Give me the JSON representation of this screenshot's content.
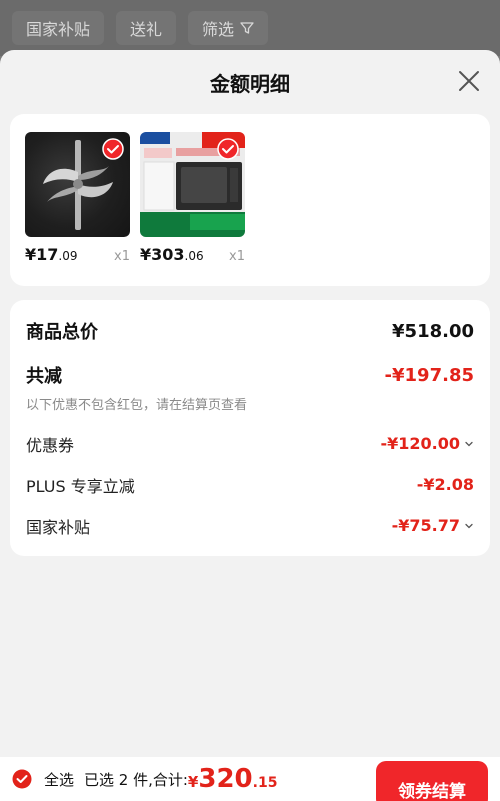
{
  "filter_bar": {
    "chips": [
      "国家补贴",
      "送礼",
      "筛选"
    ]
  },
  "sheet": {
    "title": "金额明细",
    "products": [
      {
        "price_int": "¥17",
        "price_dec": ".09",
        "qty": "x1",
        "image": "blade-attachment"
      },
      {
        "price_int": "¥303",
        "price_dec": ".06",
        "qty": "x1",
        "image": "microwave-oven"
      }
    ],
    "summary": {
      "total_label": "商品总价",
      "total_value": "¥518.00",
      "reduce_label": "共减",
      "reduce_value": "-¥197.85",
      "note": "以下优惠不包含红包，请在结算页查看",
      "items": [
        {
          "label": "优惠券",
          "value": "-¥120.00",
          "has_chevron": true
        },
        {
          "label": "PLUS 专享立减",
          "value": "-¥2.08",
          "has_chevron": false
        },
        {
          "label": "国家补贴",
          "value": "-¥75.77",
          "has_chevron": true
        }
      ]
    }
  },
  "bottom_bar": {
    "select_all": "全选",
    "selected_text": "已选 2 件,合计:",
    "grand_yen": "¥",
    "grand_int": "320",
    "grand_dec": ".15",
    "checkout": "领券结算"
  },
  "colors": {
    "accent_red": "#e2231a",
    "checkout_bg": "#f0262a"
  }
}
